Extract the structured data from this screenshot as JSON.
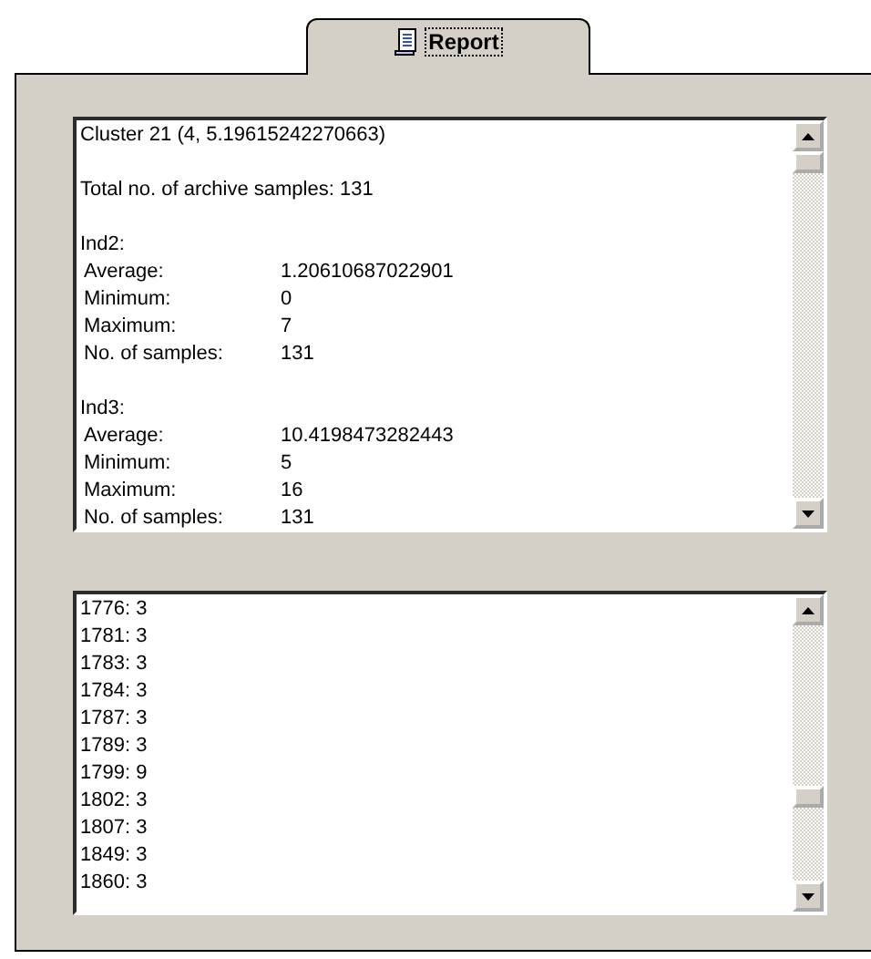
{
  "tabs": [
    {
      "label": "Report",
      "selected": true
    }
  ],
  "report": {
    "lines": [
      "Cluster 21 (4, 5.19615242270663)",
      "Total no. of archive samples: 131"
    ],
    "sections": [
      {
        "title": "Ind2:",
        "stats": [
          {
            "label": "Average:",
            "value": "1.20610687022901"
          },
          {
            "label": "Minimum:",
            "value": "0"
          },
          {
            "label": "Maximum:",
            "value": "7"
          },
          {
            "label": "No. of samples:",
            "value": "131"
          }
        ]
      },
      {
        "title": "Ind3:",
        "stats": [
          {
            "label": "Average:",
            "value": "10.4198473282443"
          },
          {
            "label": "Minimum:",
            "value": "5"
          },
          {
            "label": "Maximum:",
            "value": "16"
          },
          {
            "label": "No. of samples:",
            "value": "131"
          }
        ]
      }
    ]
  },
  "list": [
    "1776: 3",
    "1781: 3",
    "1783: 3",
    "1784: 3",
    "1787: 3",
    "1789: 3",
    "1799: 9",
    "1802: 3",
    "1807: 3",
    "1849: 3",
    "1860: 3"
  ]
}
